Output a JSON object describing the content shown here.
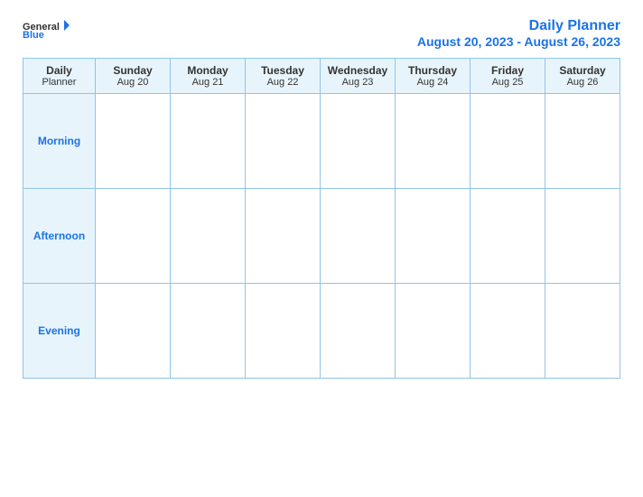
{
  "logo": {
    "general": "General",
    "blue": "Blue"
  },
  "title": {
    "line1": "Daily Planner",
    "line2": "August 20, 2023 - August 26, 2023"
  },
  "header_row": {
    "col0_line1": "Daily",
    "col0_line2": "Planner",
    "columns": [
      {
        "day": "Sunday",
        "date": "Aug 20"
      },
      {
        "day": "Monday",
        "date": "Aug 21"
      },
      {
        "day": "Tuesday",
        "date": "Aug 22"
      },
      {
        "day": "Wednesday",
        "date": "Aug 23"
      },
      {
        "day": "Thursday",
        "date": "Aug 24"
      },
      {
        "day": "Friday",
        "date": "Aug 25"
      },
      {
        "day": "Saturday",
        "date": "Aug 26"
      }
    ]
  },
  "rows": [
    {
      "label": "Morning"
    },
    {
      "label": "Afternoon"
    },
    {
      "label": "Evening"
    }
  ]
}
